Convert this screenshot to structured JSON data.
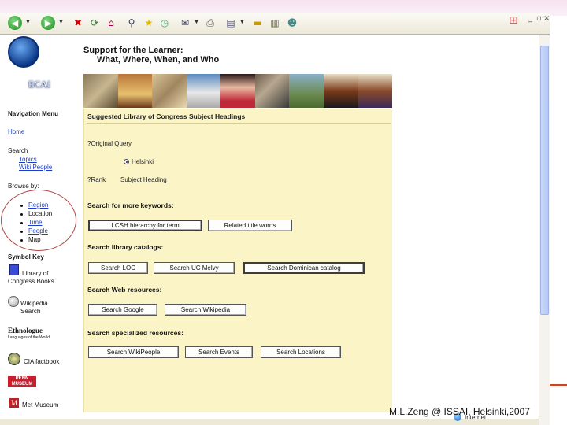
{
  "page": {
    "title": "Support for the Learner:",
    "subtitle": "What, Where, When, and Who",
    "logo_text": "ECAI"
  },
  "toolbar": {
    "icons": [
      "back-icon",
      "forward-icon",
      "stop-icon",
      "refresh-icon",
      "home-icon",
      "search-icon",
      "favorites-icon",
      "history-icon",
      "mail-icon",
      "print-icon",
      "edit-icon",
      "discuss-icon",
      "research-icon",
      "messenger-icon"
    ]
  },
  "nav": {
    "heading": "Navigation Menu",
    "home": "Home",
    "search_label": "Search",
    "topics": "Topics",
    "wikipeople": "Wiki People",
    "browse_label": "Browse by:",
    "region": "Region",
    "location": "Location",
    "time": "Time",
    "people": "People",
    "map": "Map",
    "symbol_key": "Symbol Key",
    "loc_books": "Library of Congress Books",
    "wikipedia": "Wikipedia Search",
    "ethnologue": "Ethnologue",
    "ethnologue_sub": "Languages of the World",
    "cia": "CIA factbook",
    "penn": "PENN MUSEUM",
    "met": "Met Museum"
  },
  "panel": {
    "heading": "Suggested Library of Congress Subject Headings",
    "original_query_label": "?Original Query",
    "query_value": "Helsinki",
    "rank_label": "?Rank",
    "subject_heading_label": "Subject Heading",
    "sec_keywords": "Search for more keywords:",
    "btn_lcsh": "LCSH hierarchy for term",
    "btn_related": "Related title words",
    "sec_library": "Search library catalogs:",
    "btn_loc": "Search LOC",
    "btn_ucmelvyl": "Search UC Melvy",
    "btn_dominican": "Search Dominican catalog",
    "sec_web": "Search Web resources:",
    "btn_google": "Search Google",
    "btn_wikipedia": "Search Wikipedia",
    "sec_specialized": "Search specialized resources:",
    "btn_wikipeople": "Search WikiPeople",
    "btn_events": "Search Events",
    "btn_locations": "Search Locations"
  },
  "status": {
    "internet": "Internet"
  },
  "footer": {
    "credit": "M.L.Zeng @ ISSAI, Helsinki,2007"
  },
  "colors": {
    "panel_bg": "#faf4c7",
    "link": "#1a3cc8",
    "annotation_circle": "#b14646"
  }
}
